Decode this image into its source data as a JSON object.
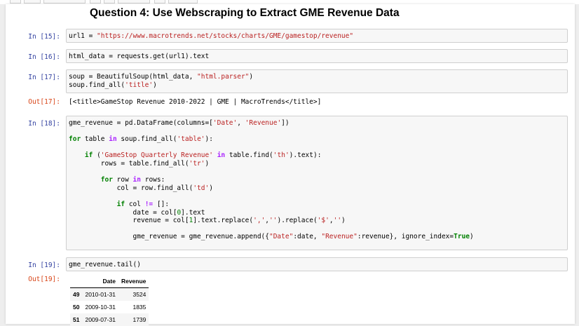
{
  "heading": "Question 4: Use Webscraping to Extract GME Revenue Data",
  "cells": [
    {
      "prompt": "In [15]:",
      "lines": [
        [
          [
            "",
            "url1 = "
          ],
          [
            "s",
            "\"https://www.macrotrends.net/stocks/charts/GME/gamestop/revenue\""
          ]
        ]
      ]
    },
    {
      "prompt": "In [16]:",
      "lines": [
        [
          [
            "",
            "html_data = requests.get(url1).text"
          ]
        ]
      ]
    },
    {
      "prompt": "In [17]:",
      "lines": [
        [
          [
            "",
            "soup = BeautifulSoup(html_data, "
          ],
          [
            "s",
            "\"html.parser\""
          ],
          [
            "",
            ")"
          ]
        ],
        [
          [
            "",
            "soup.find_all("
          ],
          [
            "s",
            "'title'"
          ],
          [
            "",
            ")"
          ]
        ]
      ]
    },
    {
      "prompt": "In [18]:",
      "lines": [
        [
          [
            "",
            "gme_revenue = pd.DataFrame(columns=["
          ],
          [
            "s",
            "'Date'"
          ],
          [
            "",
            ", "
          ],
          [
            "s",
            "'Revenue'"
          ],
          [
            "",
            "])"
          ]
        ],
        [],
        [
          [
            "k",
            "for"
          ],
          [
            "",
            " table "
          ],
          [
            "o",
            "in"
          ],
          [
            "",
            " soup.find_all("
          ],
          [
            "s",
            "'table'"
          ],
          [
            "",
            "):"
          ]
        ],
        [],
        [
          [
            "",
            "    "
          ],
          [
            "k",
            "if"
          ],
          [
            "",
            " ("
          ],
          [
            "s",
            "'GameStop Quarterly Revenue'"
          ],
          [
            "",
            " "
          ],
          [
            "o",
            "in"
          ],
          [
            "",
            " table.find("
          ],
          [
            "s",
            "'th'"
          ],
          [
            "",
            ").text):"
          ]
        ],
        [
          [
            "",
            "        rows = table.find_all("
          ],
          [
            "s",
            "'tr'"
          ],
          [
            "",
            ")"
          ]
        ],
        [],
        [
          [
            "",
            "        "
          ],
          [
            "k",
            "for"
          ],
          [
            "",
            " row "
          ],
          [
            "o",
            "in"
          ],
          [
            "",
            " rows:"
          ]
        ],
        [
          [
            "",
            "            col = row.find_all("
          ],
          [
            "s",
            "'td'"
          ],
          [
            "",
            ")"
          ]
        ],
        [],
        [
          [
            "",
            "            "
          ],
          [
            "k",
            "if"
          ],
          [
            "",
            " col "
          ],
          [
            "o",
            "!="
          ],
          [
            "",
            " []:"
          ]
        ],
        [
          [
            "",
            "                date = col["
          ],
          [
            "n",
            "0"
          ],
          [
            "",
            "].text"
          ]
        ],
        [
          [
            "",
            "                revenue = col["
          ],
          [
            "n",
            "1"
          ],
          [
            "",
            "].text.replace("
          ],
          [
            "s",
            "','"
          ],
          [
            "",
            ","
          ],
          [
            "s",
            "''"
          ],
          [
            "",
            ").replace("
          ],
          [
            "s",
            "'$'"
          ],
          [
            "",
            ","
          ],
          [
            "s",
            "''"
          ],
          [
            "",
            ")"
          ]
        ],
        [],
        [
          [
            "",
            "                gme_revenue = gme_revenue.append({"
          ],
          [
            "s",
            "\"Date\""
          ],
          [
            "",
            ":date, "
          ],
          [
            "s",
            "\"Revenue\""
          ],
          [
            "",
            ":revenue}, ignore_index="
          ],
          [
            "k",
            "True"
          ],
          [
            "",
            ")"
          ]
        ]
      ]
    },
    {
      "prompt": "In [19]:",
      "lines": [
        [
          [
            "",
            "gme_revenue.tail()"
          ]
        ]
      ]
    }
  ],
  "outputs": [
    {
      "prompt": "Out[17]:",
      "text": "[<title>GameStop Revenue 2010-2022 | GME | MacroTrends</title>]"
    },
    {
      "prompt": "Out[19]:"
    }
  ],
  "dataframe": {
    "columns": [
      "Date",
      "Revenue"
    ],
    "rows": [
      {
        "index": "49",
        "date": "2010-01-31",
        "revenue": "3524"
      },
      {
        "index": "50",
        "date": "2009-10-31",
        "revenue": "1835"
      },
      {
        "index": "51",
        "date": "2009-07-31",
        "revenue": "1739"
      }
    ]
  },
  "colors": {
    "prompt_in": "#303f9f",
    "prompt_out": "#d84315",
    "string": "#ba2121",
    "keyword": "#008000",
    "operator": "#aa22ff",
    "cell_background": "#f7f7f7"
  }
}
